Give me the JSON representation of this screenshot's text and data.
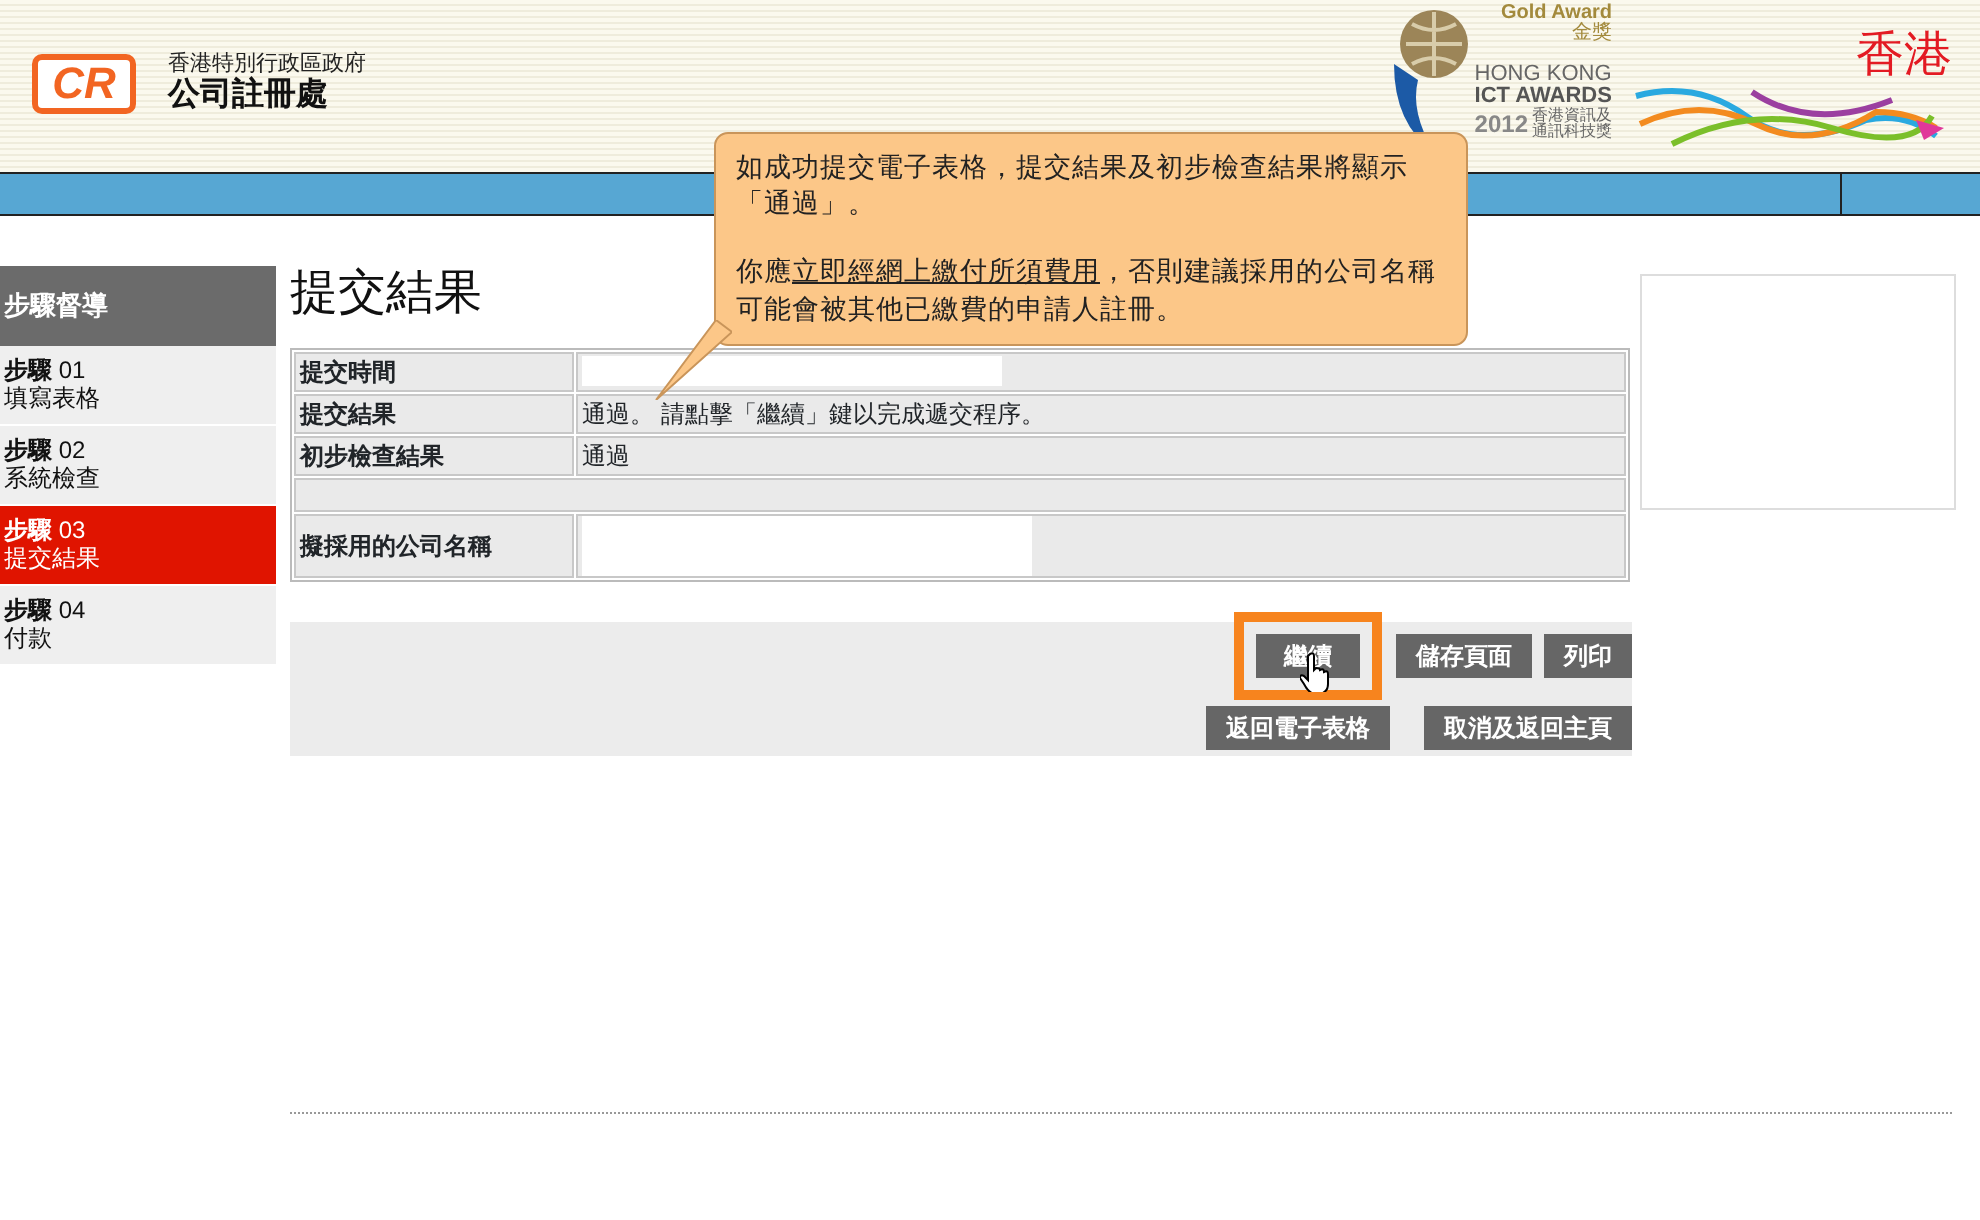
{
  "header": {
    "logo": "CR",
    "org_line1": "香港特別行政區政府",
    "org_line2": "公司註冊處",
    "award": {
      "gold": "Gold Award",
      "gold_zh": "金獎",
      "line1": "HONG KONG",
      "line2": "ICT AWARDS",
      "year": "2012",
      "zh1": "香港資訊及",
      "zh2": "通訊科技獎"
    },
    "brand": "香港"
  },
  "sidebar": {
    "title": "步驟督導",
    "items": [
      {
        "step": "步驟",
        "number": "01",
        "label": "填寫表格",
        "selected": false
      },
      {
        "step": "步驟",
        "number": "02",
        "label": "系統檢查",
        "selected": false
      },
      {
        "step": "步驟",
        "number": "03",
        "label": "提交結果",
        "selected": true
      },
      {
        "step": "步驟",
        "number": "04",
        "label": "付款",
        "selected": false
      }
    ]
  },
  "page_title": "提交結果",
  "table": {
    "rows": [
      {
        "label": "提交時間",
        "value": "",
        "kind": "field"
      },
      {
        "label": "提交結果",
        "value": "通過。 請點擊「繼續」鍵以完成遞交程序。",
        "kind": "text"
      },
      {
        "label": "初步檢查結果",
        "value": "通過",
        "kind": "text"
      },
      {
        "label": "",
        "value": "",
        "kind": "spacer"
      },
      {
        "label": "擬採用的公司名稱",
        "value": "",
        "kind": "field"
      }
    ]
  },
  "buttons_row1": [
    {
      "label": "繼續",
      "highlighted": true
    },
    {
      "label": "儲存頁面",
      "highlighted": false
    },
    {
      "label": "列印",
      "highlighted": false
    }
  ],
  "buttons_row2": [
    {
      "label": "返回電子表格",
      "highlighted": false
    },
    {
      "label": "取消及返回主頁",
      "highlighted": false
    }
  ],
  "callout": {
    "line1": "如成功提交電子表格，提交結果及初步檢查結果將顯示「通過」。",
    "before": "你應",
    "link": "立即經網上繳付所須費用",
    "after": "，否則建議採用的公司名稱可能會被其他已繳費的申請人註冊。"
  }
}
